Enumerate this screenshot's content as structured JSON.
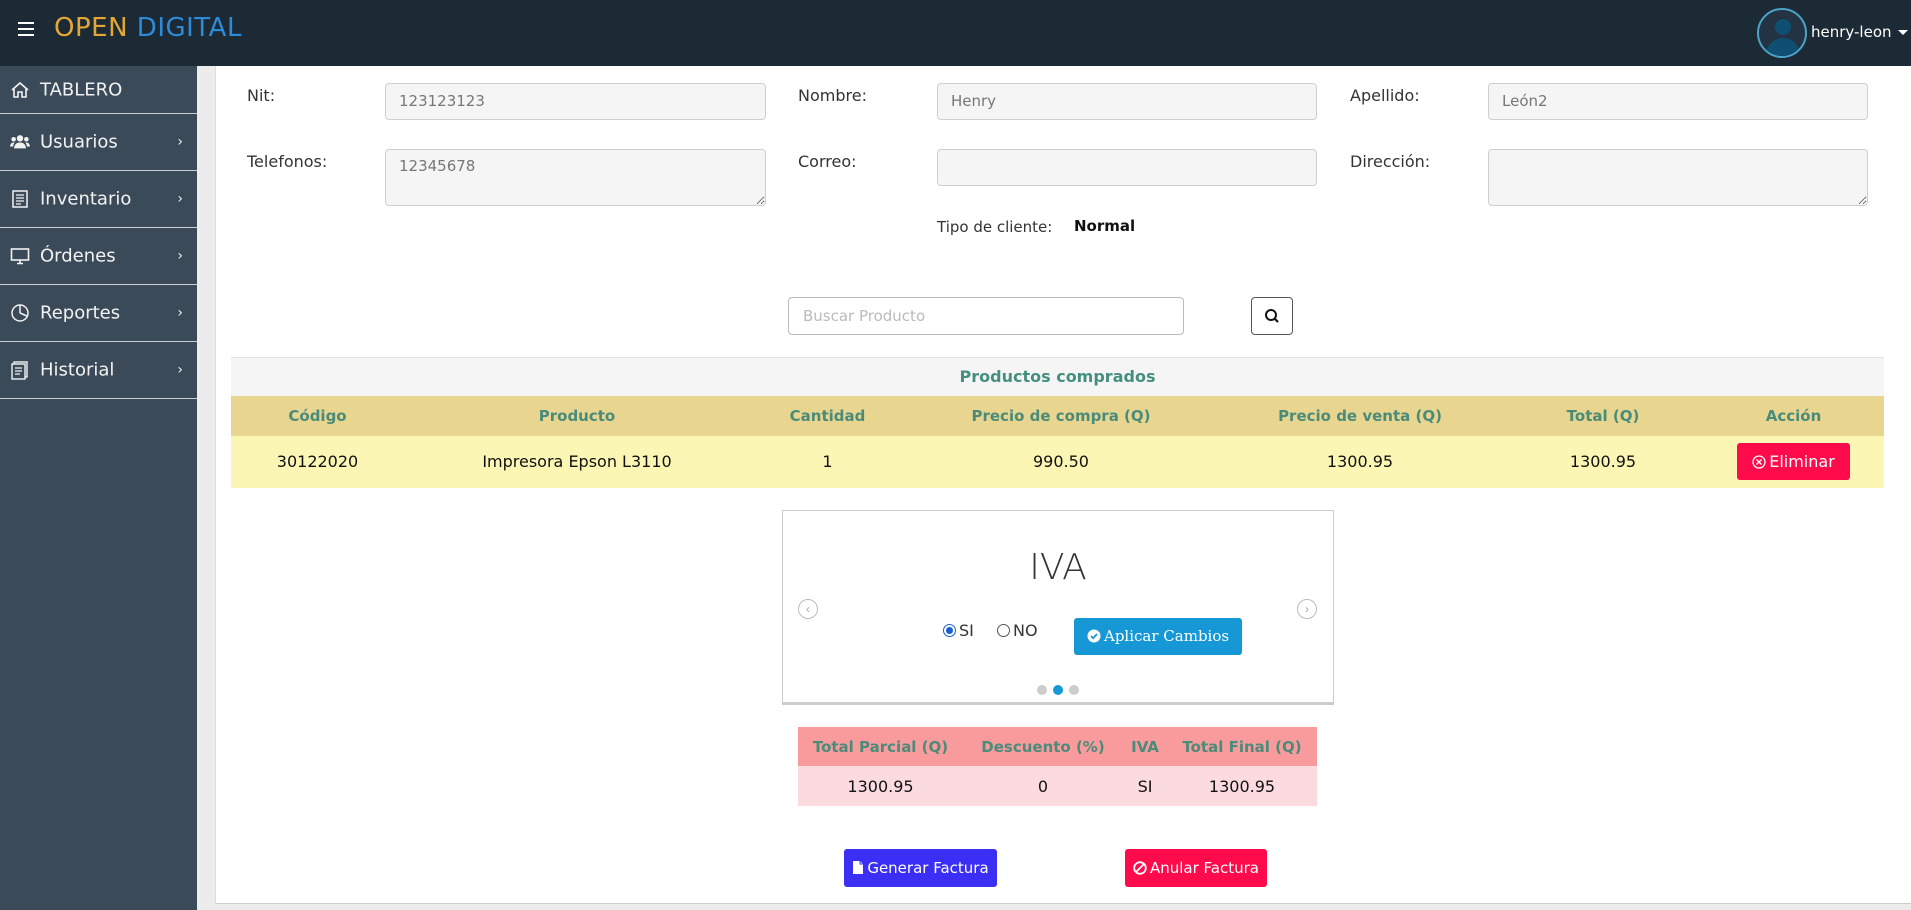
{
  "brand": {
    "part1": "OPEN",
    "part2": "DIGITAL"
  },
  "user": {
    "name": "henry-leon"
  },
  "sidebar": {
    "items": [
      {
        "label": "TABLERO",
        "icon": "home-icon"
      },
      {
        "label": "Usuarios",
        "icon": "users-icon"
      },
      {
        "label": "Inventario",
        "icon": "list-icon"
      },
      {
        "label": "Órdenes",
        "icon": "monitor-icon"
      },
      {
        "label": "Reportes",
        "icon": "pie-chart-icon"
      },
      {
        "label": "Historial",
        "icon": "history-icon"
      }
    ]
  },
  "client": {
    "nit_label": "Nit:",
    "nit_value": "123123123",
    "nombre_label": "Nombre:",
    "nombre_value": "Henry",
    "apellido_label": "Apellido:",
    "apellido_value": "León2",
    "telefonos_label": "Telefonos:",
    "telefonos_value": "12345678",
    "correo_label": "Correo:",
    "correo_value": "",
    "direccion_label": "Dirección:",
    "direccion_value": "",
    "tipo_label": "Tipo de cliente:",
    "tipo_value": "Normal"
  },
  "search": {
    "placeholder": "Buscar Producto"
  },
  "products": {
    "caption": "Productos comprados",
    "headers": [
      "Código",
      "Producto",
      "Cantidad",
      "Precio de compra (Q)",
      "Precio de venta (Q)",
      "Total (Q)",
      "Acción"
    ],
    "rows": [
      {
        "codigo": "30122020",
        "producto": "Impresora Epson L3110",
        "cantidad": "1",
        "compra": "990.50",
        "venta": "1300.95",
        "total": "1300.95",
        "accion": "Eliminar"
      }
    ]
  },
  "carousel": {
    "title": "IVA",
    "options": [
      "SI",
      "NO"
    ],
    "selected": "SI",
    "apply_label": "Aplicar Cambios",
    "slides": 3,
    "active_slide": 2
  },
  "totals": {
    "headers": [
      "Total Parcial (Q)",
      "Descuento (%)",
      "IVA",
      "Total Final (Q)"
    ],
    "values": [
      "1300.95",
      "0",
      "SI",
      "1300.95"
    ]
  },
  "actions": {
    "generate": "Generar Factura",
    "cancel": "Anular Factura"
  },
  "colors": {
    "topbar": "#1c2a36",
    "sidebar": "#3a4a58",
    "brand_orange": "#e4a634",
    "brand_blue": "#2e8bd8",
    "danger": "#ff0a4a",
    "primary": "#3b2ff5",
    "info": "#1798d6"
  }
}
